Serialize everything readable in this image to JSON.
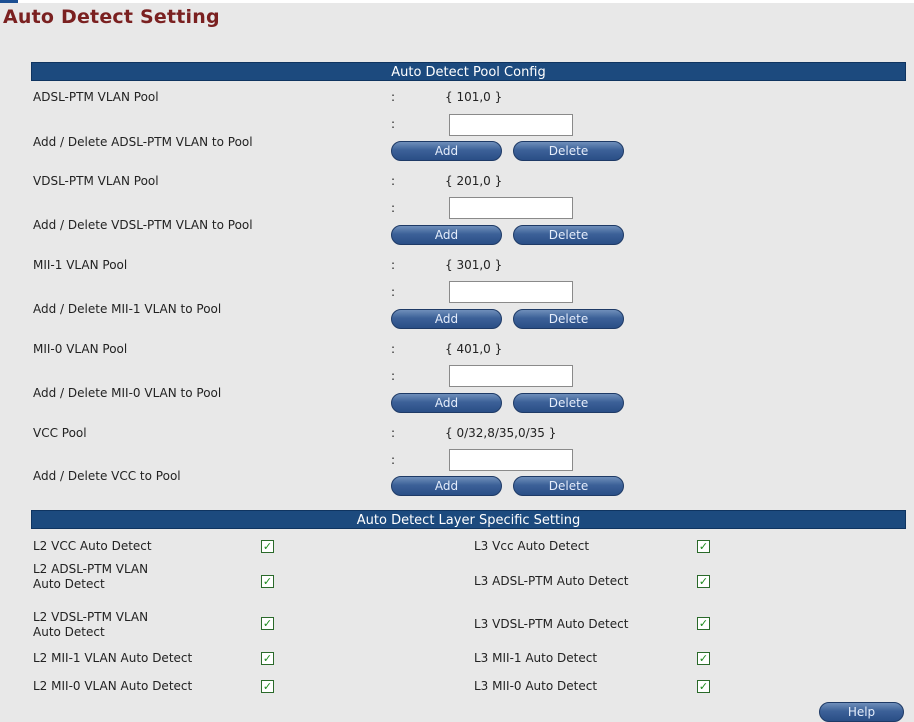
{
  "page": {
    "title": "Auto Detect Setting"
  },
  "pool_config": {
    "header": "Auto Detect Pool Config",
    "rows": [
      {
        "kind": "value",
        "label": "ADSL-PTM VLAN Pool",
        "colon": ":",
        "value": "{ 101,0 }"
      },
      {
        "kind": "edit",
        "label": "Add / Delete ADSL-PTM VLAN to Pool",
        "colon": ":",
        "input_value": "",
        "add": "Add",
        "delete": "Delete"
      },
      {
        "kind": "value",
        "label": "VDSL-PTM VLAN Pool",
        "colon": ":",
        "value": "{ 201,0 }"
      },
      {
        "kind": "edit",
        "label": "Add / Delete VDSL-PTM VLAN to Pool",
        "colon": ":",
        "input_value": "",
        "add": "Add",
        "delete": "Delete"
      },
      {
        "kind": "value",
        "label": "MII-1 VLAN Pool",
        "colon": ":",
        "value": "{ 301,0 }"
      },
      {
        "kind": "edit",
        "label": "Add / Delete MII-1 VLAN to Pool",
        "colon": ":",
        "input_value": "",
        "add": "Add",
        "delete": "Delete"
      },
      {
        "kind": "value",
        "label": "MII-0 VLAN Pool",
        "colon": ":",
        "value": "{ 401,0 }"
      },
      {
        "kind": "edit",
        "label": "Add / Delete MII-0 VLAN to Pool",
        "colon": ":",
        "input_value": "",
        "add": "Add",
        "delete": "Delete"
      },
      {
        "kind": "value",
        "label": "VCC Pool",
        "colon": ":",
        "value": "{ 0/32,8/35,0/35 }"
      },
      {
        "kind": "edit",
        "label": "Add / Delete VCC to Pool",
        "colon": ":",
        "input_value": "",
        "add": "Add",
        "delete": "Delete"
      }
    ]
  },
  "layer_setting": {
    "header": "Auto Detect Layer Specific Setting",
    "rows": [
      {
        "l2_label": "L2 VCC Auto Detect",
        "l2_checked": true,
        "l3_label": "L3 Vcc Auto Detect",
        "l3_checked": true
      },
      {
        "l2_label": "L2 ADSL-PTM VLAN Auto Detect",
        "l2_checked": true,
        "l3_label": "L3 ADSL-PTM Auto Detect",
        "l3_checked": true
      },
      {
        "l2_label": "L2 VDSL-PTM VLAN Auto Detect",
        "l2_checked": true,
        "l3_label": "L3 VDSL-PTM Auto Detect",
        "l3_checked": true
      },
      {
        "l2_label": "L2 MII-1 VLAN Auto Detect",
        "l2_checked": true,
        "l3_label": "L3 MII-1 Auto Detect",
        "l3_checked": true
      },
      {
        "l2_label": "L2 MII-0 VLAN Auto Detect",
        "l2_checked": true,
        "l3_label": "L3 MII-0 Auto Detect",
        "l3_checked": true
      }
    ]
  },
  "help_button": "Help",
  "icons": {
    "checkmark": "checkmark-icon"
  },
  "colors": {
    "header_bg": "#1c4a7e",
    "title": "#7a2020",
    "button": "#3c6198",
    "check": "#1b8a1b"
  }
}
